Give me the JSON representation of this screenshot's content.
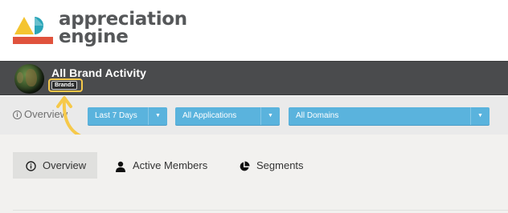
{
  "brand": {
    "line1": "appreciation",
    "line2": "engine",
    "colors": {
      "teal": "#2aa5b8",
      "yellow": "#f4c431",
      "red": "#e0533d",
      "text": "#555759"
    }
  },
  "header": {
    "title": "All Brand Activity",
    "badge": "Brands",
    "highlight_color": "#f6c94a"
  },
  "filters": {
    "overview_label": "Overview",
    "date_range": "Last 7 Days",
    "applications": "All Applications",
    "domains": "All Domains",
    "dropdown_color": "#5ab3dd"
  },
  "tabs": [
    {
      "label": "Overview",
      "icon": "info-circle-icon",
      "selected": true
    },
    {
      "label": "Active Members",
      "icon": "person-icon",
      "selected": false
    },
    {
      "label": "Segments",
      "icon": "pie-chart-icon",
      "selected": false
    }
  ]
}
